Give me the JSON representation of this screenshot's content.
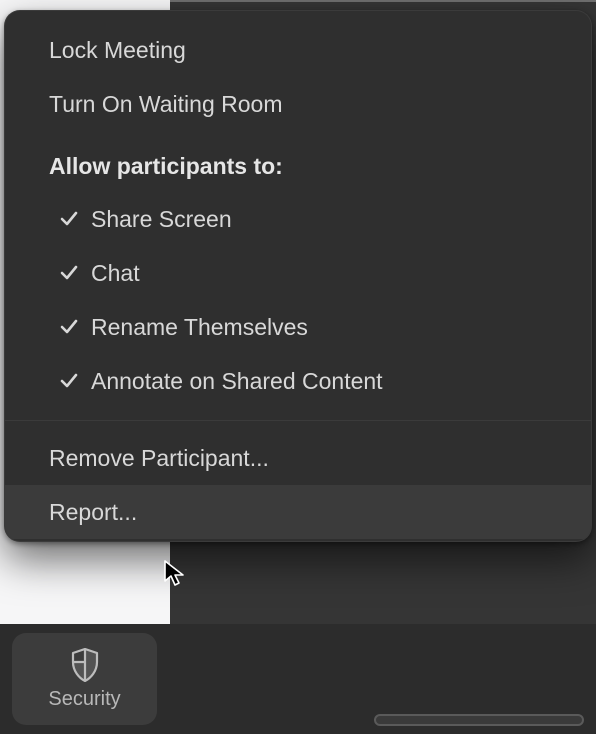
{
  "menu": {
    "lock_meeting": "Lock Meeting",
    "waiting_room": "Turn On Waiting Room",
    "allow_header": "Allow participants to:",
    "permissions": [
      {
        "label": "Share Screen",
        "checked": true
      },
      {
        "label": "Chat",
        "checked": true
      },
      {
        "label": "Rename Themselves",
        "checked": true
      },
      {
        "label": "Annotate on Shared Content",
        "checked": true
      }
    ],
    "remove_participant": "Remove Participant...",
    "report": "Report..."
  },
  "toolbar": {
    "security_label": "Security"
  }
}
